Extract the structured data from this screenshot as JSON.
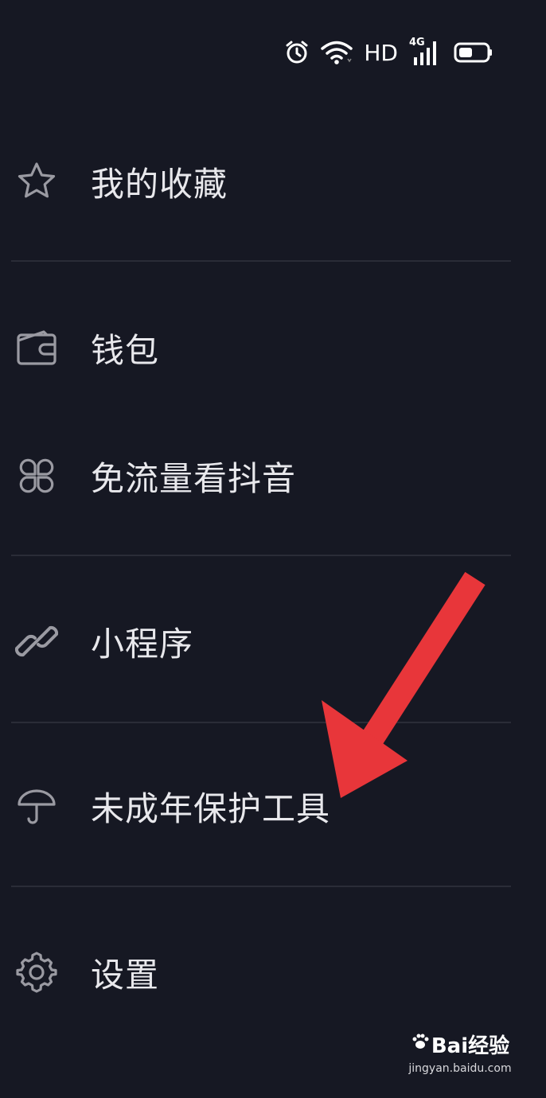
{
  "status_bar": {
    "hd": "HD",
    "network": "4G",
    "icons": [
      "alarm-icon",
      "wifi-icon",
      "signal-icon",
      "battery-icon"
    ]
  },
  "menu": {
    "items": [
      {
        "label": "我的收藏",
        "icon": "star-icon"
      },
      {
        "label": "钱包",
        "icon": "wallet-icon"
      },
      {
        "label": "免流量看抖音",
        "icon": "four-petal-icon"
      },
      {
        "label": "小程序",
        "icon": "link-icon"
      },
      {
        "label": "未成年保护工具",
        "icon": "umbrella-icon"
      },
      {
        "label": "设置",
        "icon": "gear-icon"
      }
    ]
  },
  "annotation": {
    "arrow_color": "#e8363a"
  },
  "watermark": {
    "brand": "Bai经验",
    "url": "jingyan.baidu.com"
  },
  "colors": {
    "background": "#161823",
    "text": "#e8e8ec",
    "icon": "#9a9aa2",
    "divider": "#2a2c37"
  }
}
